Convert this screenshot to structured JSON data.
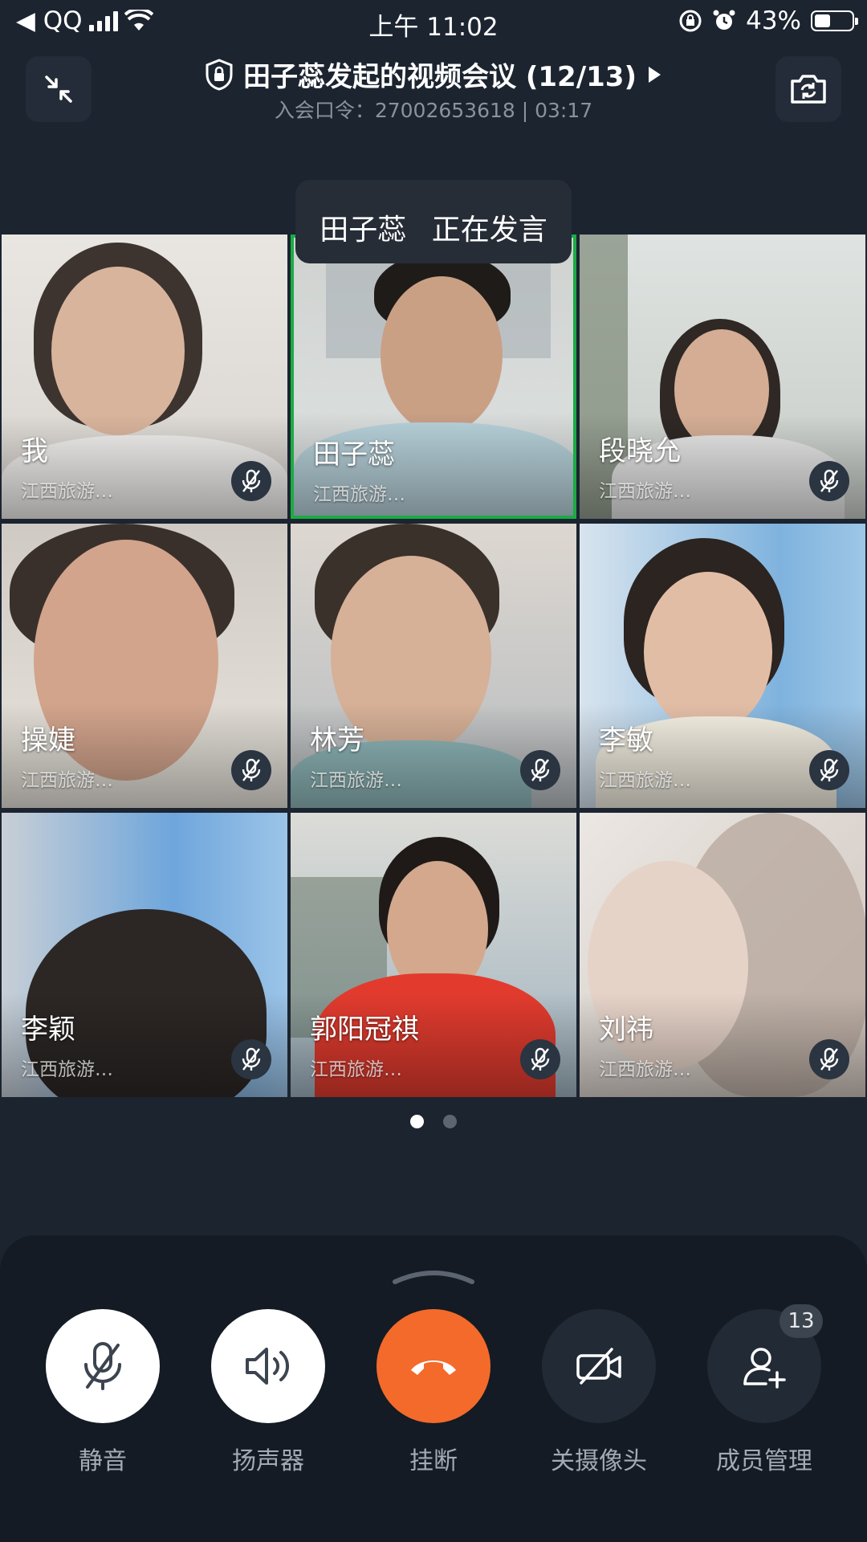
{
  "status_bar": {
    "back_label": "◀ QQ",
    "time": "上午 11:02",
    "battery_text": "43%",
    "battery_level": 0.43
  },
  "header": {
    "title": "田子蕊发起的视频会议 (12/13)",
    "subtitle": "入会口令：27002653618 | 03:17"
  },
  "speaking_banner": {
    "name": "田子蕊",
    "status": "正在发言"
  },
  "participants": [
    {
      "name": "我",
      "org": "江西旅游…",
      "muted": false,
      "active": false
    },
    {
      "name": "田子蕊",
      "org": "江西旅游…",
      "muted": false,
      "active": true
    },
    {
      "name": "段晓允",
      "org": "江西旅游…",
      "muted": true,
      "active": false
    },
    {
      "name": "操婕",
      "org": "江西旅游…",
      "muted": true,
      "active": false
    },
    {
      "name": "林芳",
      "org": "江西旅游…",
      "muted": true,
      "active": false
    },
    {
      "name": "李敏",
      "org": "江西旅游…",
      "muted": true,
      "active": false
    },
    {
      "name": "李颖",
      "org": "江西旅游…",
      "muted": true,
      "active": false
    },
    {
      "name": "郭阳冠祺",
      "org": "江西旅游…",
      "muted": true,
      "active": false
    },
    {
      "name": "刘祎",
      "org": "江西旅游…",
      "muted": true,
      "active": false
    }
  ],
  "pager": {
    "pages": 2,
    "current": 1
  },
  "controls": {
    "mute": "静音",
    "speaker": "扬声器",
    "hangup": "挂断",
    "camera_off": "关摄像头",
    "members": "成员管理",
    "member_count": "13"
  },
  "colors": {
    "hangup": "#f46a2b",
    "active_border": "#1aab45",
    "background": "#1c2430"
  }
}
